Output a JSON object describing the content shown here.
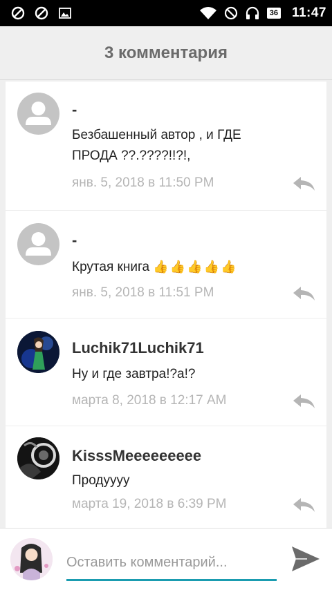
{
  "status_bar": {
    "battery": "36",
    "time": "11:47"
  },
  "header": {
    "title": "3 комментария"
  },
  "comments": [
    {
      "author": "-",
      "text": "Безбашенный автор , и ГДЕ ПРОДА ??.????!!?!,",
      "date": "янв. 5, 2018 в 11:50 PM"
    },
    {
      "author": "-",
      "text": "Крутая книга",
      "emoji": "👍👍👍👍👍",
      "date": "янв. 5, 2018 в 11:51 PM"
    },
    {
      "author": "Luchik71Luchik71",
      "text": "Ну и где завтра!?а!?",
      "date": "марта 8, 2018 в 12:17 AM"
    },
    {
      "author": "KisssMeeeeeeeee",
      "text": "Продуууу",
      "date": "марта 19, 2018 в 6:39 PM"
    }
  ],
  "composer": {
    "placeholder": "Оставить комментарий..."
  },
  "colors": {
    "accent": "#1a9cb0",
    "emoji": "#e0609a"
  }
}
